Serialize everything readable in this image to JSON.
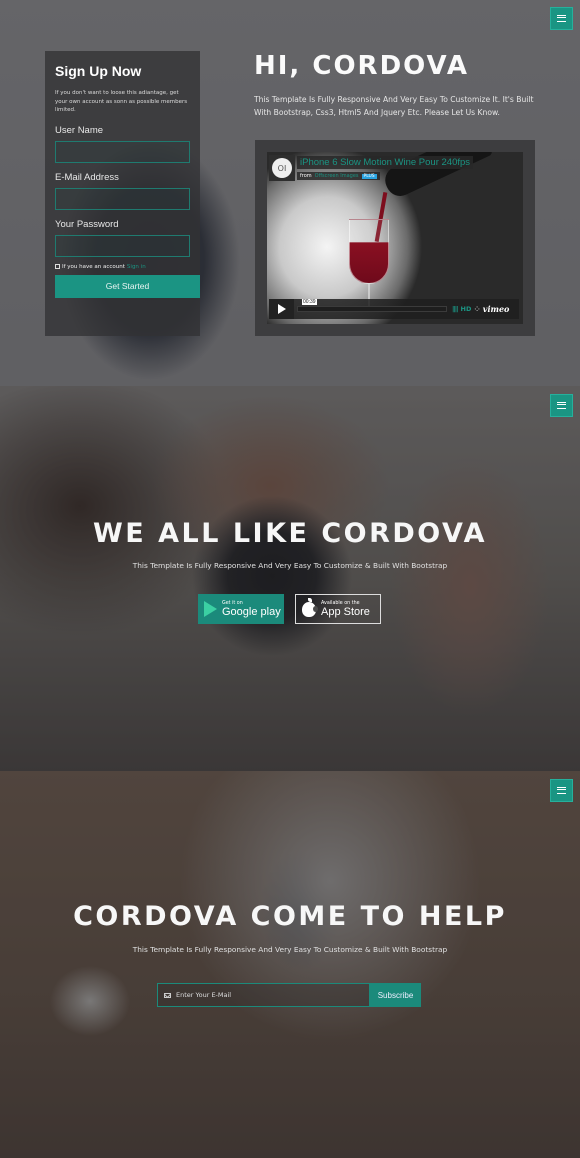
{
  "accent_color": "#1b9483",
  "section1": {
    "menu_icon": "hamburger-menu-icon",
    "signup": {
      "title": "Sign Up Now",
      "description": "If you don't want to loose this adiantage, get your own account as sonn as possible members limited.",
      "username_label": "User Name",
      "username_value": "",
      "email_label": "E-Mail Address",
      "email_value": "",
      "password_label": "Your Password",
      "password_value": "",
      "have_account_text": "If you have an account",
      "sign_in_link": "Sign in",
      "submit_label": "Get Started"
    },
    "hero_title": "HI, CORDOVA",
    "hero_subtitle": "This Template Is Fully Responsive And Very Easy To Customize It. It's Built With Bootstrap, Css3, Html5 And Jquery Etc. Please Let Us Know.",
    "video": {
      "avatar_text": "OI",
      "title": "iPhone 6 Slow Motion Wine Pour 240fps",
      "from_label": "from",
      "author": "Offscreen Images",
      "badge": "PLUS",
      "time": "00:39",
      "hd_label": "HD",
      "brand": "vimeo"
    }
  },
  "section2": {
    "menu_icon": "hamburger-menu-icon",
    "title": "WE ALL LIKE CORDOVA",
    "subtitle": "This Template Is Fully Responsive And Very Easy To Customize & Built With Bootstrap",
    "google_play": {
      "small": "Get it on",
      "big": "Google play"
    },
    "app_store": {
      "small": "Available on the",
      "big": "App Store"
    }
  },
  "section3": {
    "menu_icon": "hamburger-menu-icon",
    "title": "CORDOVA COME TO HELP",
    "subtitle": "This Template Is Fully Responsive And Very Easy To Customize & Built With Bootstrap",
    "email_placeholder": "Enter Your E-Mail",
    "subscribe_label": "Subscribe"
  }
}
